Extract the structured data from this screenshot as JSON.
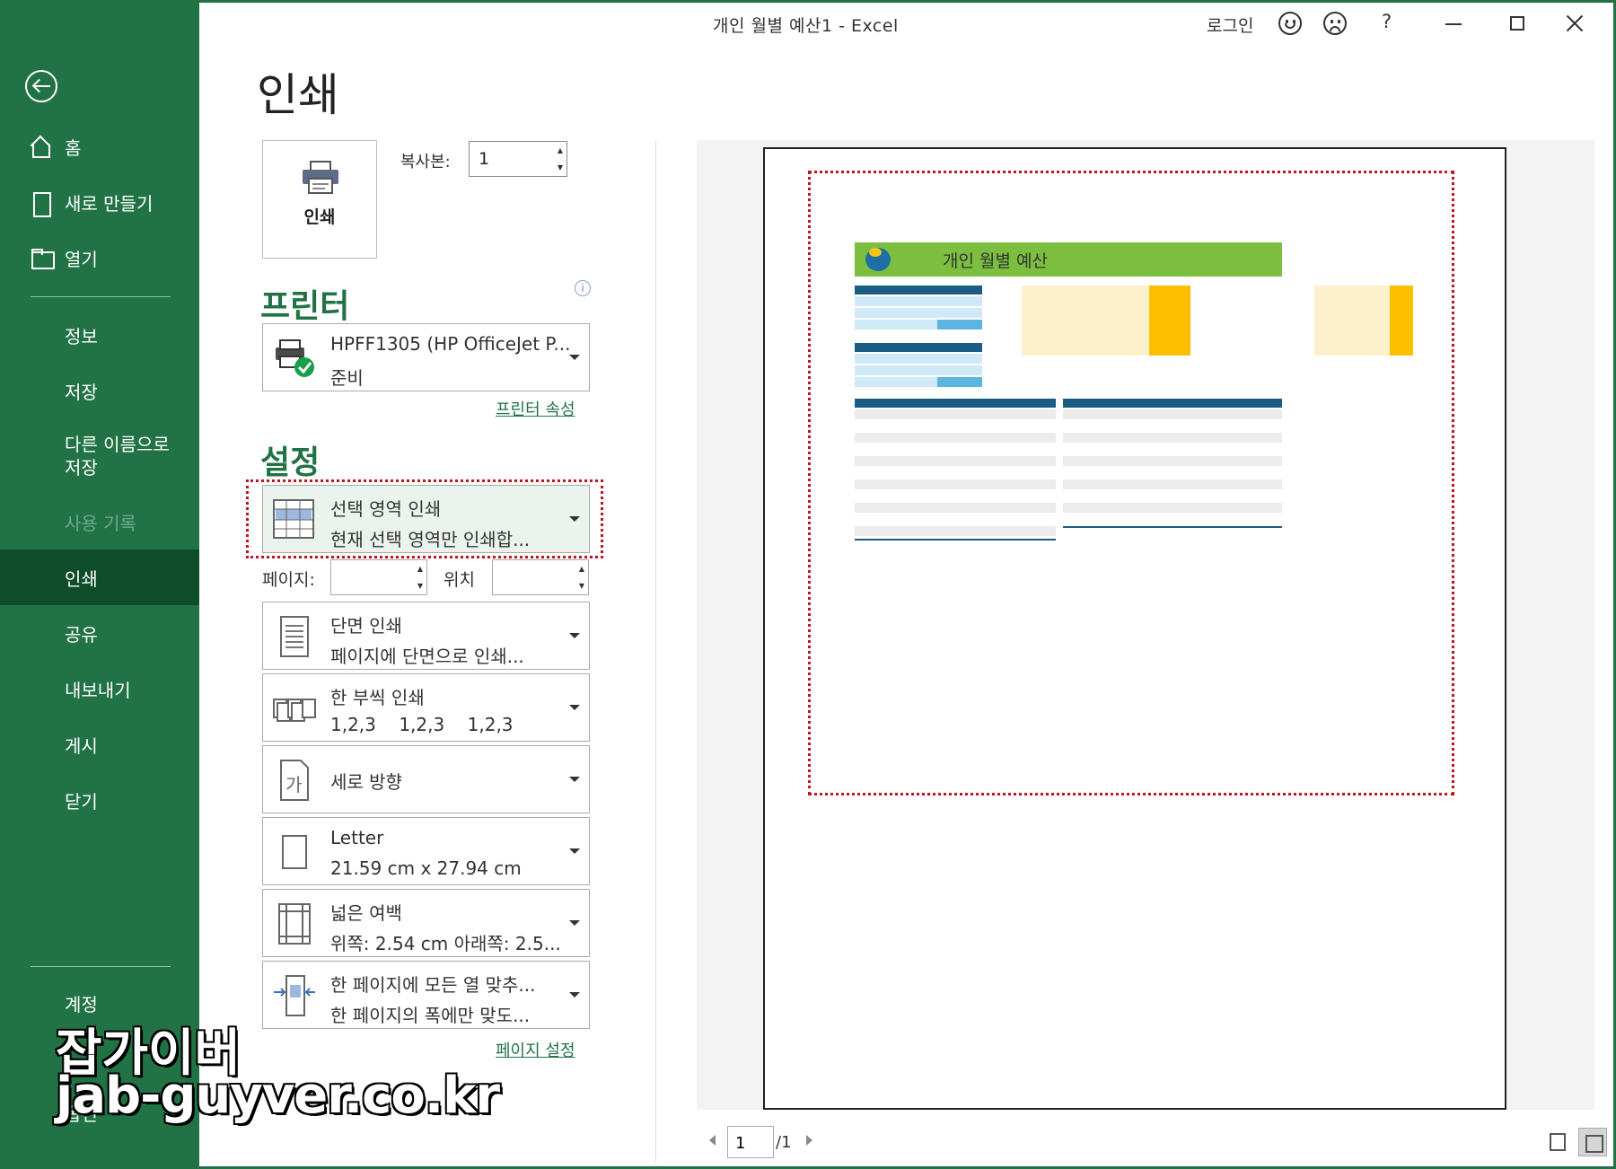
{
  "window": {
    "title": "개인 월별 예산1  -  Excel",
    "login": "로그인",
    "help": "?"
  },
  "sidebar": {
    "top_items": [
      {
        "label": "홈",
        "icon": "home-icon"
      },
      {
        "label": "새로 만들기",
        "icon": "new-document-icon"
      },
      {
        "label": "열기",
        "icon": "open-folder-icon"
      }
    ],
    "items": [
      {
        "label": "정보"
      },
      {
        "label": "저장"
      },
      {
        "label": "다른 이름으로\n저장"
      },
      {
        "label": "사용 기록",
        "disabled": true
      },
      {
        "label": "인쇄",
        "active": true
      },
      {
        "label": "공유"
      },
      {
        "label": "내보내기"
      },
      {
        "label": "게시"
      },
      {
        "label": "닫기"
      }
    ],
    "bottom_items": [
      {
        "label": "계정"
      },
      {
        "label": "옵션"
      }
    ]
  },
  "main": {
    "title": "인쇄",
    "print_button": "인쇄",
    "copies_label": "복사본:",
    "copies_value": "1",
    "printer_section": "프린터",
    "printer_name": "HPFF1305 (HP OfficeJet P...",
    "printer_status": "준비",
    "printer_properties": "프린터 속성",
    "settings_section": "설정",
    "print_what": {
      "line1": "선택 영역 인쇄",
      "line2": "현재 선택 영역만 인쇄합..."
    },
    "pages_label": "페이지:",
    "position_label": "위치",
    "sides": {
      "line1": "단면 인쇄",
      "line2": "페이지에 단면으로 인쇄..."
    },
    "collate": {
      "line1": "한 부씩 인쇄",
      "line2": "1,2,3    1,2,3    1,2,3"
    },
    "orientation": {
      "line1": "세로 방향"
    },
    "paper": {
      "line1": "Letter",
      "line2": "21.59 cm x 27.94 cm"
    },
    "margins": {
      "line1": "넓은 여백",
      "line2": "위쪽: 2.54 cm 아래쪽: 2.5..."
    },
    "scaling": {
      "line1": "한 페이지에 모든 열 맞추...",
      "line2": "한 페이지의 폭에만 맞도..."
    },
    "page_setup": "페이지 설정"
  },
  "preview": {
    "sheet_title": "개인 월별 예산",
    "current_page": "1",
    "total_pages": "/1"
  },
  "watermark": {
    "line1": "잡가이버",
    "line2": "jab-guyver.co.kr"
  },
  "colors": {
    "accent": "#217346",
    "selection_border": "#c0141e",
    "banner_green": "#7cbf3f",
    "bar_gold": "#fbbf00"
  }
}
